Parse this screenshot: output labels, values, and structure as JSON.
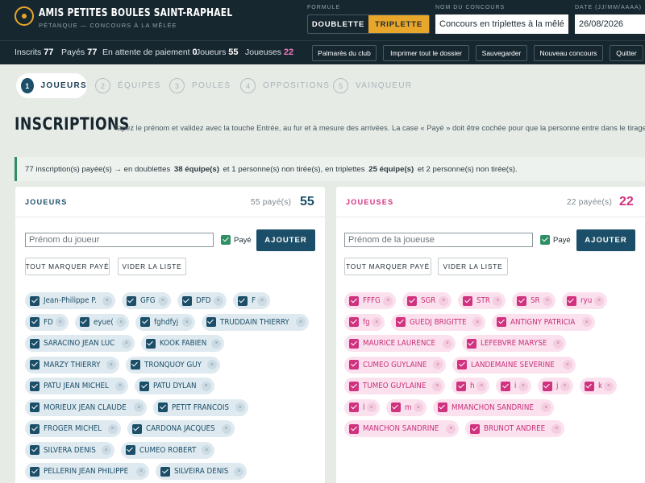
{
  "header": {
    "club_name": "AMIS PETITES BOULES SAINT-RAPHAEL",
    "club_subtitle": "PÉTANQUE — CONCOURS À LA MÊLÉE",
    "format_label": "FORMULE",
    "format_options": [
      "DOUBLETTE",
      "TRIPLETTE"
    ],
    "format_selected": "TRIPLETTE",
    "contest_label": "NOM DU CONCOURS",
    "contest_name": "Concours en triplettes à la mêlée",
    "date_label": "DATE (JJ/MM/AAAA)",
    "date_value": "26/08/2026"
  },
  "stats": {
    "inscrits_label": "Inscrits",
    "inscrits": "77",
    "payes_label": "Payés",
    "payes": "77",
    "attente_label": "En attente de paiement",
    "attente": "0",
    "joueurs_label": "Joueurs",
    "joueurs": "55",
    "joueuses_label": "Joueuses",
    "joueuses": "22"
  },
  "actions": [
    "Palmarès du club",
    "Imprimer tout le dossier",
    "Sauvegarder",
    "Nouveau concours",
    "Quitter"
  ],
  "steps": [
    {
      "num": "1",
      "label": "JOUEURS",
      "active": true
    },
    {
      "num": "2",
      "label": "ÉQUIPES",
      "active": false
    },
    {
      "num": "3",
      "label": "POULES",
      "active": false
    },
    {
      "num": "4",
      "label": "OPPOSITIONS",
      "active": false
    },
    {
      "num": "5",
      "label": "VAINQUEUR",
      "active": false
    }
  ],
  "page": {
    "title": "INSCRIPTIONS",
    "instructions": "Tapez le prénom et validez avec la touche Entrée, au fur et à mesure des arrivées. La case « Payé » doit être cochée pour que la personne entre dans le tirage."
  },
  "summary": {
    "part1": "77 inscription(s) payée(s) → en doublettes",
    "doublettes_teams": "38 équipe(s)",
    "part2": "et 1 personne(s) non tirée(s), en triplettes",
    "triplettes_teams": "25 équipe(s)",
    "part3": "et 2 personne(s) non tirée(s)."
  },
  "men": {
    "title": "JOUEURS",
    "paid_text": "55 payé(s)",
    "count": "55",
    "input_placeholder": "Prénom du joueur",
    "paid_label": "Payé",
    "add_label": "AJOUTER",
    "mark_all_label": "TOUT MARQUER PAYÉ",
    "clear_label": "VIDER LA LISTE",
    "rows": [
      [
        "Jean-Philippe P.",
        "GFG",
        "DFD",
        "F"
      ],
      [
        "FD",
        "eyue(",
        "fghdfyj",
        "TRUDDAIN THIERRY"
      ],
      [
        "SARACINO JEAN LUC",
        "KOOK FABIEN"
      ],
      [
        "MARZY THIERRY",
        "TRONQUOY GUY"
      ],
      [
        "PATU JEAN MICHEL",
        "PATU DYLAN"
      ],
      [
        "MORIEUX JEAN CLAUDE",
        "PETIT FRANCOIS"
      ],
      [
        "FROGER MICHEL",
        "CARDONA JACQUES"
      ],
      [
        "SILVERA DENIS",
        "CUMEO ROBERT"
      ],
      [
        "PELLERIN JEAN PHILIPPE",
        "SILVEIRA DENIS"
      ]
    ]
  },
  "women": {
    "title": "JOUEUSES",
    "paid_text": "22 payée(s)",
    "count": "22",
    "input_placeholder": "Prénom de la joueuse",
    "paid_label": "Payé",
    "add_label": "AJOUTER",
    "mark_all_label": "TOUT MARQUER PAYÉ",
    "clear_label": "VIDER LA LISTE",
    "rows": [
      [
        "FFFG",
        "SGR",
        "STR",
        "SR",
        "ryu"
      ],
      [
        "fg",
        "GUEDJ BRIGITTE",
        "ANTIGNY PATRICIA"
      ],
      [
        "MAURICE LAURENCE",
        "LEFEBVRE MARYSE"
      ],
      [
        "CUMEO GUYLAINE",
        "LANDEMAINE SEVERINE"
      ],
      [
        "TUMEO GUYLAINE",
        "h",
        "i",
        "j",
        "k"
      ],
      [
        "l",
        "m",
        "MMANCHON SANDRINE"
      ],
      [
        "MANCHON SANDRINE",
        "BRUNOT ANDREE"
      ]
    ]
  },
  "icons": {
    "checkbox": "check-icon",
    "remove": "remove-x-icon",
    "logo": "boule-logo-icon"
  }
}
